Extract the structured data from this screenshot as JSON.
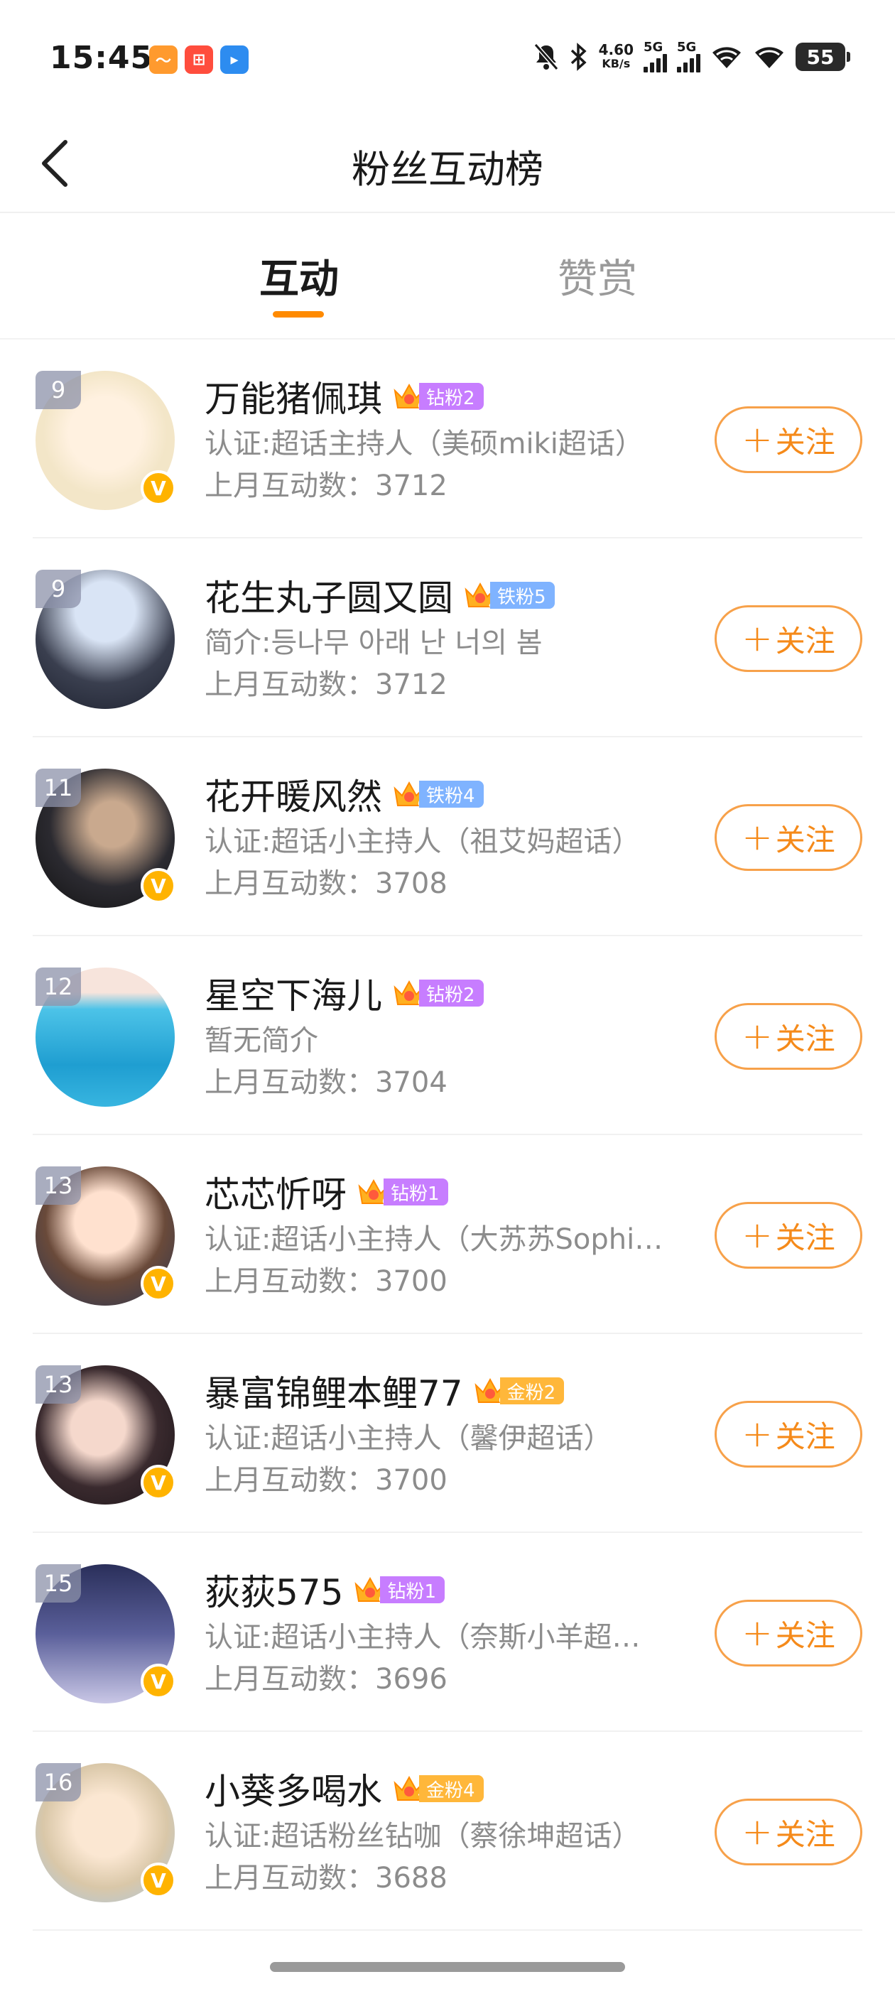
{
  "status": {
    "time": "15:45",
    "net_speed_value": "4.60",
    "net_speed_unit": "KB/s",
    "sig1": "5G",
    "sig2": "5G",
    "battery": "55",
    "icons": [
      "app-orange-icon",
      "app-red-icon",
      "app-blue-icon",
      "mute-icon",
      "bluetooth-icon",
      "signal-icon",
      "wifi-icon"
    ]
  },
  "header": {
    "title": "粉丝互动榜",
    "back_icon": "chevron-left-icon"
  },
  "tabs": [
    {
      "label": "互动",
      "active": true
    },
    {
      "label": "赞赏",
      "active": false
    }
  ],
  "follow_label": "关注",
  "colors": {
    "accent": "#ff8a00",
    "follow": "#f58a1a",
    "diamond": "#c77dff",
    "iron": "#7fb3ff",
    "gold": "#ffb73a",
    "v_badge": "#ffb300"
  },
  "users": [
    {
      "rank": "9",
      "name": "万能猪佩琪",
      "badge_level": "6",
      "badge_label": "钻粉2",
      "badge_type": "diamond",
      "desc": "认证:超话主持人（美硕miki超话）",
      "count": "上月互动数：3712",
      "verified": true
    },
    {
      "rank": "9",
      "name": "花生丸子圆又圆",
      "badge_level": "4",
      "badge_label": "铁粉5",
      "badge_type": "iron",
      "desc": "简介:등나무 아래 난 너의 봄",
      "count": "上月互动数：3712",
      "verified": false
    },
    {
      "rank": "11",
      "name": "花开暖风然",
      "badge_level": "6",
      "badge_label": "铁粉4",
      "badge_type": "iron",
      "desc": "认证:超话小主持人（祖艾妈超话）",
      "count": "上月互动数：3708",
      "verified": true
    },
    {
      "rank": "12",
      "name": "星空下海儿",
      "badge_level": "6",
      "badge_label": "钻粉2",
      "badge_type": "diamond",
      "desc": "暂无简介",
      "count": "上月互动数：3704",
      "verified": false
    },
    {
      "rank": "13",
      "name": "芯芯忻呀",
      "badge_level": "6",
      "badge_label": "钻粉1",
      "badge_type": "diamond",
      "desc": "认证:超话小主持人（大苏苏Sophi…",
      "count": "上月互动数：3700",
      "verified": true
    },
    {
      "rank": "13",
      "name": "暴富锦鲤本鲤77",
      "badge_level": "6",
      "badge_label": "金粉2",
      "badge_type": "gold",
      "desc": "认证:超话小主持人（馨伊超话）",
      "count": "上月互动数：3700",
      "verified": true
    },
    {
      "rank": "15",
      "name": "荻荻575",
      "badge_level": "6",
      "badge_label": "钻粉1",
      "badge_type": "diamond",
      "desc": "认证:超话小主持人（奈斯小羊超…",
      "count": "上月互动数：3696",
      "verified": true
    },
    {
      "rank": "16",
      "name": "小葵多喝水",
      "badge_level": "7",
      "badge_label": "金粉4",
      "badge_type": "gold",
      "desc": "认证:超话粉丝钻咖（蔡徐坤超话）",
      "count": "上月互动数：3688",
      "verified": true
    }
  ]
}
